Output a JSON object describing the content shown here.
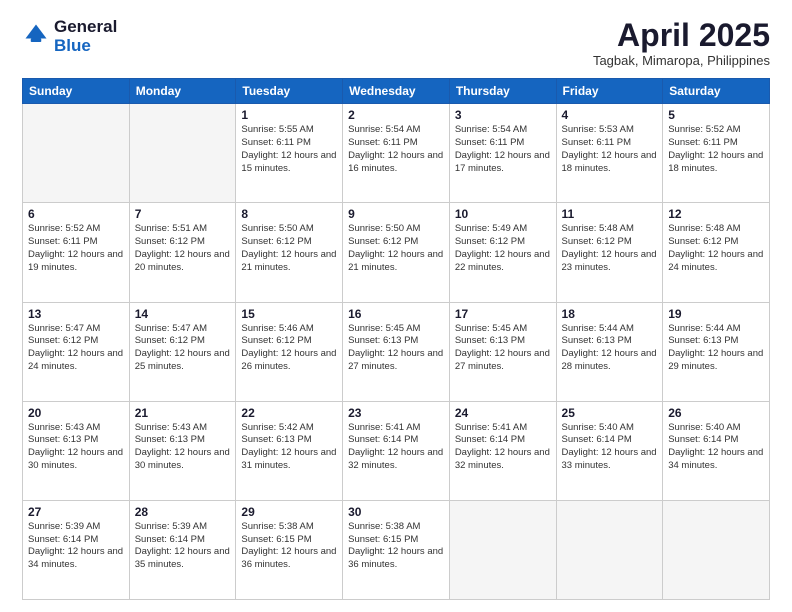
{
  "logo": {
    "general": "General",
    "blue": "Blue"
  },
  "title": "April 2025",
  "subtitle": "Tagbak, Mimaropa, Philippines",
  "days_of_week": [
    "Sunday",
    "Monday",
    "Tuesday",
    "Wednesday",
    "Thursday",
    "Friday",
    "Saturday"
  ],
  "weeks": [
    [
      {
        "day": "",
        "info": ""
      },
      {
        "day": "",
        "info": ""
      },
      {
        "day": "1",
        "info": "Sunrise: 5:55 AM\nSunset: 6:11 PM\nDaylight: 12 hours and 15 minutes."
      },
      {
        "day": "2",
        "info": "Sunrise: 5:54 AM\nSunset: 6:11 PM\nDaylight: 12 hours and 16 minutes."
      },
      {
        "day": "3",
        "info": "Sunrise: 5:54 AM\nSunset: 6:11 PM\nDaylight: 12 hours and 17 minutes."
      },
      {
        "day": "4",
        "info": "Sunrise: 5:53 AM\nSunset: 6:11 PM\nDaylight: 12 hours and 18 minutes."
      },
      {
        "day": "5",
        "info": "Sunrise: 5:52 AM\nSunset: 6:11 PM\nDaylight: 12 hours and 18 minutes."
      }
    ],
    [
      {
        "day": "6",
        "info": "Sunrise: 5:52 AM\nSunset: 6:11 PM\nDaylight: 12 hours and 19 minutes."
      },
      {
        "day": "7",
        "info": "Sunrise: 5:51 AM\nSunset: 6:12 PM\nDaylight: 12 hours and 20 minutes."
      },
      {
        "day": "8",
        "info": "Sunrise: 5:50 AM\nSunset: 6:12 PM\nDaylight: 12 hours and 21 minutes."
      },
      {
        "day": "9",
        "info": "Sunrise: 5:50 AM\nSunset: 6:12 PM\nDaylight: 12 hours and 21 minutes."
      },
      {
        "day": "10",
        "info": "Sunrise: 5:49 AM\nSunset: 6:12 PM\nDaylight: 12 hours and 22 minutes."
      },
      {
        "day": "11",
        "info": "Sunrise: 5:48 AM\nSunset: 6:12 PM\nDaylight: 12 hours and 23 minutes."
      },
      {
        "day": "12",
        "info": "Sunrise: 5:48 AM\nSunset: 6:12 PM\nDaylight: 12 hours and 24 minutes."
      }
    ],
    [
      {
        "day": "13",
        "info": "Sunrise: 5:47 AM\nSunset: 6:12 PM\nDaylight: 12 hours and 24 minutes."
      },
      {
        "day": "14",
        "info": "Sunrise: 5:47 AM\nSunset: 6:12 PM\nDaylight: 12 hours and 25 minutes."
      },
      {
        "day": "15",
        "info": "Sunrise: 5:46 AM\nSunset: 6:12 PM\nDaylight: 12 hours and 26 minutes."
      },
      {
        "day": "16",
        "info": "Sunrise: 5:45 AM\nSunset: 6:13 PM\nDaylight: 12 hours and 27 minutes."
      },
      {
        "day": "17",
        "info": "Sunrise: 5:45 AM\nSunset: 6:13 PM\nDaylight: 12 hours and 27 minutes."
      },
      {
        "day": "18",
        "info": "Sunrise: 5:44 AM\nSunset: 6:13 PM\nDaylight: 12 hours and 28 minutes."
      },
      {
        "day": "19",
        "info": "Sunrise: 5:44 AM\nSunset: 6:13 PM\nDaylight: 12 hours and 29 minutes."
      }
    ],
    [
      {
        "day": "20",
        "info": "Sunrise: 5:43 AM\nSunset: 6:13 PM\nDaylight: 12 hours and 30 minutes."
      },
      {
        "day": "21",
        "info": "Sunrise: 5:43 AM\nSunset: 6:13 PM\nDaylight: 12 hours and 30 minutes."
      },
      {
        "day": "22",
        "info": "Sunrise: 5:42 AM\nSunset: 6:13 PM\nDaylight: 12 hours and 31 minutes."
      },
      {
        "day": "23",
        "info": "Sunrise: 5:41 AM\nSunset: 6:14 PM\nDaylight: 12 hours and 32 minutes."
      },
      {
        "day": "24",
        "info": "Sunrise: 5:41 AM\nSunset: 6:14 PM\nDaylight: 12 hours and 32 minutes."
      },
      {
        "day": "25",
        "info": "Sunrise: 5:40 AM\nSunset: 6:14 PM\nDaylight: 12 hours and 33 minutes."
      },
      {
        "day": "26",
        "info": "Sunrise: 5:40 AM\nSunset: 6:14 PM\nDaylight: 12 hours and 34 minutes."
      }
    ],
    [
      {
        "day": "27",
        "info": "Sunrise: 5:39 AM\nSunset: 6:14 PM\nDaylight: 12 hours and 34 minutes."
      },
      {
        "day": "28",
        "info": "Sunrise: 5:39 AM\nSunset: 6:14 PM\nDaylight: 12 hours and 35 minutes."
      },
      {
        "day": "29",
        "info": "Sunrise: 5:38 AM\nSunset: 6:15 PM\nDaylight: 12 hours and 36 minutes."
      },
      {
        "day": "30",
        "info": "Sunrise: 5:38 AM\nSunset: 6:15 PM\nDaylight: 12 hours and 36 minutes."
      },
      {
        "day": "",
        "info": ""
      },
      {
        "day": "",
        "info": ""
      },
      {
        "day": "",
        "info": ""
      }
    ]
  ]
}
